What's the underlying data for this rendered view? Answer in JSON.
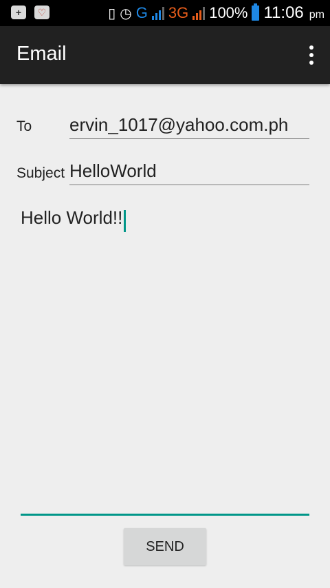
{
  "status_bar": {
    "network_1": "G",
    "network_2": "3G",
    "battery": "100%",
    "time": "11:06",
    "ampm": "pm",
    "icons": [
      "add-notification-icon",
      "app-notification-icon",
      "vibrate-icon",
      "alarm-icon",
      "signal-icon",
      "battery-icon"
    ],
    "colors": {
      "network_1": "#1e88e5",
      "network_2": "#e85d1b",
      "battery": "#1e88e5"
    }
  },
  "action_bar": {
    "title": "Email",
    "menu_icon": "overflow-menu-icon"
  },
  "form": {
    "to_label": "To",
    "to_value": "ervin_1017@yahoo.com.ph",
    "subject_label": "Subject",
    "subject_value": "HelloWorld",
    "message_value": "Hello World!!"
  },
  "send_label": "SEND",
  "accent_color": "#009688"
}
